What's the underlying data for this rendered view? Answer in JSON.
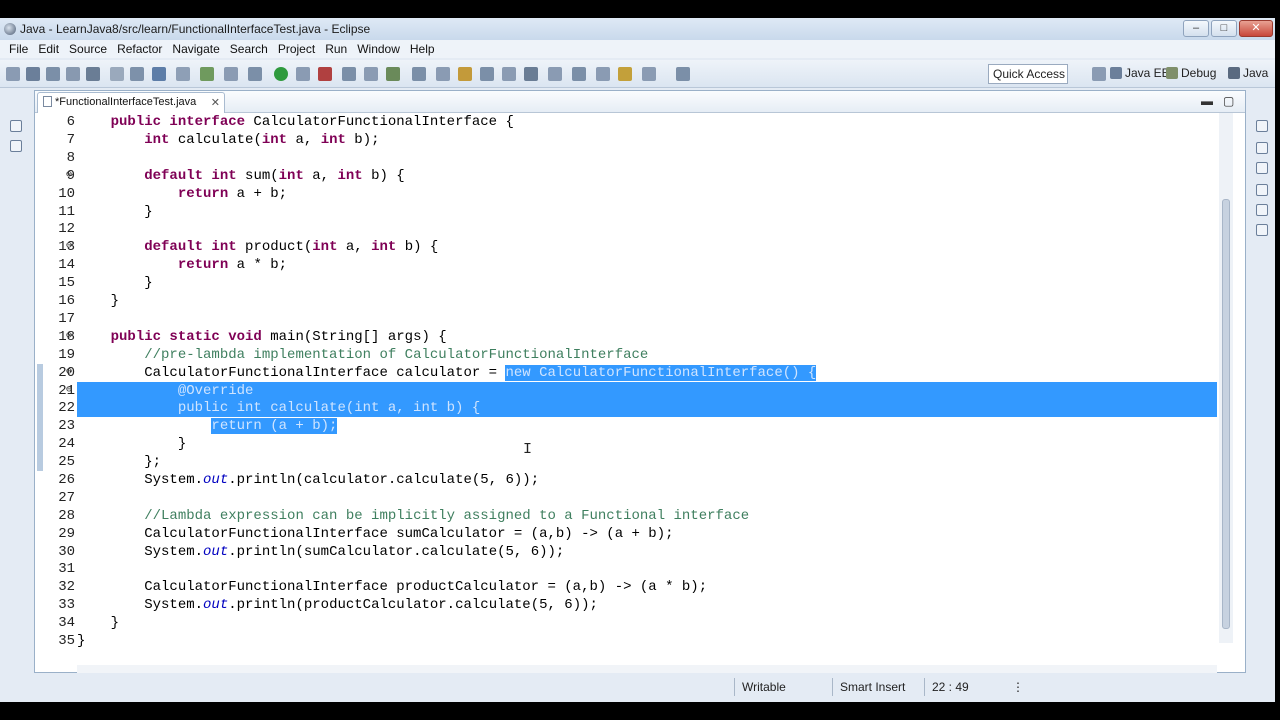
{
  "window": {
    "title": "Java - LearnJava8/src/learn/FunctionalInterfaceTest.java - Eclipse"
  },
  "menu": [
    "File",
    "Edit",
    "Source",
    "Refactor",
    "Navigate",
    "Search",
    "Project",
    "Run",
    "Window",
    "Help"
  ],
  "toolbar": {
    "quick_access_label": "Quick Access",
    "perspectives": [
      "Java EE",
      "Debug",
      "Java"
    ]
  },
  "editor": {
    "tab_label": "*FunctionalInterfaceTest.java",
    "close_glyph": "✕",
    "lines": [
      {
        "n": "6",
        "segs": [
          [
            "    ",
            ""
          ],
          [
            "public interface",
            "kw"
          ],
          [
            " CalculatorFunctionalInterface {",
            ""
          ]
        ]
      },
      {
        "n": "7",
        "segs": [
          [
            "        ",
            ""
          ],
          [
            "int",
            "kw"
          ],
          [
            " calculate(",
            ""
          ],
          [
            "int",
            "kw"
          ],
          [
            " a, ",
            ""
          ],
          [
            "int",
            "kw"
          ],
          [
            " b);",
            ""
          ]
        ]
      },
      {
        "n": "8",
        "segs": []
      },
      {
        "n": "9",
        "fold": "⊖",
        "segs": [
          [
            "        ",
            ""
          ],
          [
            "default int",
            "kw"
          ],
          [
            " sum(",
            ""
          ],
          [
            "int",
            "kw"
          ],
          [
            " a, ",
            ""
          ],
          [
            "int",
            "kw"
          ],
          [
            " b) {",
            ""
          ]
        ]
      },
      {
        "n": "10",
        "segs": [
          [
            "            ",
            ""
          ],
          [
            "return",
            "kw"
          ],
          [
            " a + b;",
            ""
          ]
        ]
      },
      {
        "n": "11",
        "segs": [
          [
            "        }",
            ""
          ]
        ]
      },
      {
        "n": "12",
        "segs": []
      },
      {
        "n": "13",
        "fold": "⊖",
        "segs": [
          [
            "        ",
            ""
          ],
          [
            "default int",
            "kw"
          ],
          [
            " product(",
            ""
          ],
          [
            "int",
            "kw"
          ],
          [
            " a, ",
            ""
          ],
          [
            "int",
            "kw"
          ],
          [
            " b) {",
            ""
          ]
        ]
      },
      {
        "n": "14",
        "segs": [
          [
            "            ",
            ""
          ],
          [
            "return",
            "kw"
          ],
          [
            " a * b;",
            ""
          ]
        ]
      },
      {
        "n": "15",
        "segs": [
          [
            "        }",
            ""
          ]
        ]
      },
      {
        "n": "16",
        "segs": [
          [
            "    }",
            ""
          ]
        ]
      },
      {
        "n": "17",
        "segs": []
      },
      {
        "n": "18",
        "fold": "⊖",
        "segs": [
          [
            "    ",
            ""
          ],
          [
            "public static void",
            "kw"
          ],
          [
            " main(String[] args) {",
            ""
          ]
        ]
      },
      {
        "n": "19",
        "segs": [
          [
            "        ",
            ""
          ],
          [
            "//pre-lambda implementation of CalculatorFunctionalInterface",
            "cm"
          ]
        ]
      },
      {
        "n": "20",
        "fold": "⊖",
        "bp": true,
        "segs": [
          [
            "        CalculatorFunctionalInterface calculator = ",
            ""
          ],
          [
            "new CalculatorFunctionalInterface() {",
            "sel"
          ]
        ]
      },
      {
        "n": "21",
        "fold": "⊖",
        "bp": true,
        "band": true,
        "segs": [
          [
            "            @Override",
            "sel"
          ]
        ]
      },
      {
        "n": "22",
        "bp": true,
        "band": true,
        "segs": [
          [
            "            public int calculate(int a, int b) {",
            "sel"
          ]
        ]
      },
      {
        "n": "23",
        "bp": true,
        "segs": [
          [
            "                ",
            ""
          ],
          [
            "return (a + b);",
            "sel"
          ]
        ]
      },
      {
        "n": "24",
        "bp": true,
        "segs": [
          [
            "            }",
            ""
          ]
        ]
      },
      {
        "n": "25",
        "bp": true,
        "segs": [
          [
            "        };",
            ""
          ]
        ]
      },
      {
        "n": "26",
        "segs": [
          [
            "        System.",
            ""
          ],
          [
            "out",
            "fld"
          ],
          [
            ".println(calculator.calculate(5, 6));",
            ""
          ]
        ]
      },
      {
        "n": "27",
        "segs": []
      },
      {
        "n": "28",
        "segs": [
          [
            "        ",
            ""
          ],
          [
            "//Lambda expression can be implicitly assigned to a Functional interface",
            "cm"
          ]
        ]
      },
      {
        "n": "29",
        "segs": [
          [
            "        CalculatorFunctionalInterface sumCalculator = (a,b) -> (a + b);",
            ""
          ]
        ]
      },
      {
        "n": "30",
        "segs": [
          [
            "        System.",
            ""
          ],
          [
            "out",
            "fld"
          ],
          [
            ".println(sumCalculator.calculate(5, 6));",
            ""
          ]
        ]
      },
      {
        "n": "31",
        "segs": []
      },
      {
        "n": "32",
        "segs": [
          [
            "        CalculatorFunctionalInterface productCalculator = (a,b) -> (a * b);",
            ""
          ]
        ]
      },
      {
        "n": "33",
        "segs": [
          [
            "        System.",
            ""
          ],
          [
            "out",
            "fld"
          ],
          [
            ".println(productCalculator.calculate(5, 6));",
            ""
          ]
        ]
      },
      {
        "n": "34",
        "segs": [
          [
            "    }",
            ""
          ]
        ]
      },
      {
        "n": "35",
        "segs": [
          [
            "}",
            ""
          ]
        ]
      }
    ]
  },
  "status": {
    "writable": "Writable",
    "insert_mode": "Smart Insert",
    "position": "22 : 49"
  },
  "colors": {
    "selection": "#3399ff",
    "keyword": "#7f0055",
    "comment": "#3f7f5f",
    "field": "#0000c0"
  }
}
